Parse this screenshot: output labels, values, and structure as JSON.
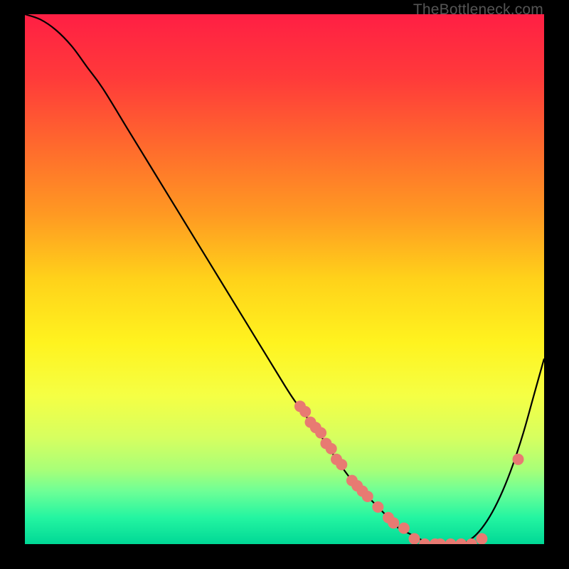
{
  "attribution": "TheBottleneck.com",
  "colors": {
    "gradient_stops": [
      {
        "offset": 0.0,
        "color": "#ff1f44"
      },
      {
        "offset": 0.12,
        "color": "#ff3a3a"
      },
      {
        "offset": 0.25,
        "color": "#ff6a2d"
      },
      {
        "offset": 0.38,
        "color": "#ff9a22"
      },
      {
        "offset": 0.5,
        "color": "#ffd21a"
      },
      {
        "offset": 0.62,
        "color": "#fff31f"
      },
      {
        "offset": 0.72,
        "color": "#f5ff44"
      },
      {
        "offset": 0.8,
        "color": "#d6ff60"
      },
      {
        "offset": 0.86,
        "color": "#a8ff78"
      },
      {
        "offset": 0.9,
        "color": "#6eff96"
      },
      {
        "offset": 0.95,
        "color": "#24f5a1"
      },
      {
        "offset": 1.0,
        "color": "#00d896"
      }
    ],
    "curve": "#000000",
    "dot_fill": "#e87a72",
    "dot_stroke": "#b45a54"
  },
  "chart_data": {
    "type": "line",
    "title": "",
    "xlabel": "",
    "ylabel": "",
    "xlim": [
      0,
      100
    ],
    "ylim": [
      0,
      100
    ],
    "grid": false,
    "series": [
      {
        "name": "bottleneck-curve",
        "x": [
          0,
          3,
          6,
          9,
          12,
          15,
          20,
          25,
          30,
          35,
          40,
          45,
          50,
          52,
          55,
          58,
          60,
          63,
          65,
          68,
          70,
          72,
          74,
          76,
          78,
          80,
          82,
          84,
          86,
          88,
          90,
          92,
          94,
          96,
          98,
          100
        ],
        "y": [
          100,
          99,
          97,
          94,
          90,
          86,
          78,
          70,
          62,
          54,
          46,
          38,
          30,
          27,
          23,
          19,
          16,
          12,
          10,
          7,
          5,
          3,
          2,
          1,
          0,
          0,
          0,
          0,
          1,
          3,
          6,
          10,
          15,
          21,
          28,
          35
        ]
      }
    ],
    "markers": {
      "name": "sample-points",
      "x": [
        53,
        54,
        55,
        56,
        57,
        58,
        59,
        60,
        61,
        63,
        64,
        65,
        66,
        68,
        70,
        71,
        73,
        75,
        77,
        79,
        80,
        82,
        84,
        86,
        88,
        95
      ],
      "y": [
        26,
        25,
        23,
        22,
        21,
        19,
        18,
        16,
        15,
        12,
        11,
        10,
        9,
        7,
        5,
        4,
        3,
        1,
        0,
        0,
        0,
        0,
        0,
        0,
        1,
        16
      ]
    }
  }
}
